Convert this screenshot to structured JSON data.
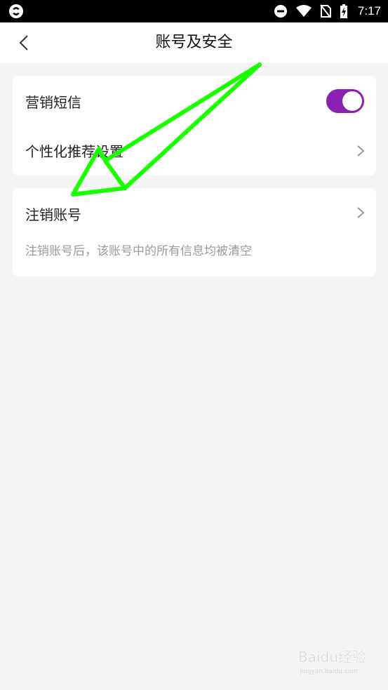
{
  "status_bar": {
    "time": "7:17",
    "icons": [
      "app-logo-icon",
      "do-not-disturb-icon",
      "wifi-icon",
      "no-sim-icon",
      "battery-charging-icon"
    ]
  },
  "header": {
    "title": "账号及安全",
    "back_icon": "chevron-left-icon"
  },
  "settings": {
    "marketing_sms": {
      "label": "营销短信",
      "enabled": true,
      "toggle_color": "#8a1fb0"
    },
    "personalized_recommendation": {
      "label": "个性化推荐设置"
    },
    "cancel_account": {
      "label": "注销账号",
      "description": "注销账号后，该账号中的所有信息均被清空"
    }
  },
  "annotation": {
    "arrow_color": "#19ff00"
  },
  "watermark": {
    "brand": "Baidu经验",
    "sub": "jingyan.baidu.com"
  }
}
